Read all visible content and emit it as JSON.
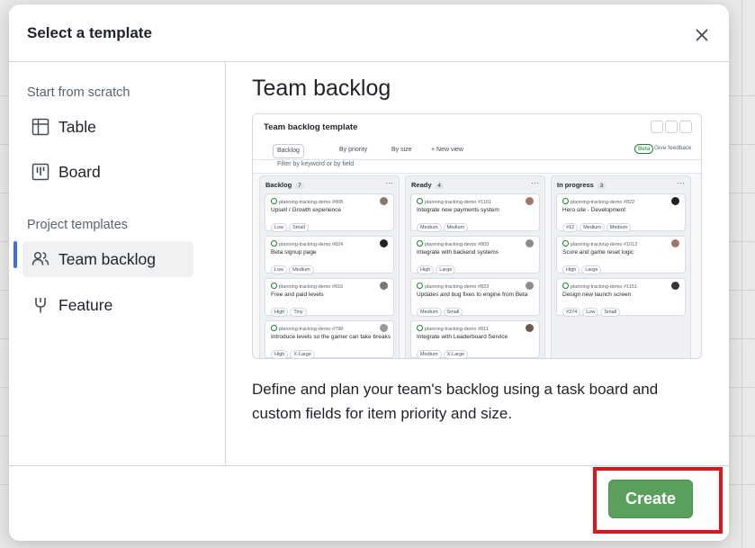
{
  "dialog": {
    "title": "Select a template",
    "close_icon": "close-icon"
  },
  "sidebar": {
    "scratch_label": "Start from scratch",
    "scratch_items": [
      {
        "label": "Table",
        "icon": "table-icon"
      },
      {
        "label": "Board",
        "icon": "board-icon"
      }
    ],
    "templates_label": "Project templates",
    "template_items": [
      {
        "label": "Team backlog",
        "icon": "people-icon",
        "selected": true
      },
      {
        "label": "Feature",
        "icon": "feature-icon",
        "selected": false
      }
    ]
  },
  "detail": {
    "title": "Team backlog",
    "description": "Define and plan your team's backlog using a task board and custom fields for item priority and size."
  },
  "preview": {
    "title": "Team backlog template",
    "tabs": [
      "Backlog",
      "By priority",
      "By size",
      "+  New view"
    ],
    "beta": "Beta",
    "feedback": "Give feedback",
    "filter_placeholder": "Filter by keyword or by field",
    "columns": [
      {
        "name": "Backlog",
        "count": "7",
        "cards": [
          {
            "ref": "planning-tracking-demo #808",
            "title": "Upsell / Growth experience",
            "chips": [
              "Low",
              "Small"
            ]
          },
          {
            "ref": "planning-tracking-demo #824",
            "title": "Beta signup page",
            "chips": [
              "Low",
              "Medium"
            ]
          },
          {
            "ref": "planning-tracking-demo #816",
            "title": "Free and paid levels",
            "chips": [
              "High",
              "Tiny"
            ]
          },
          {
            "ref": "planning-tracking-demo #798",
            "title": "Introduce levels so the gamer can take breaks",
            "chips": [
              "High",
              "X-Large"
            ]
          }
        ]
      },
      {
        "name": "Ready",
        "count": "4",
        "cards": [
          {
            "ref": "planning-tracking-demo #1101",
            "title": "Integrate new payments system",
            "chips": [
              "Medium",
              "Medium"
            ]
          },
          {
            "ref": "planning-tracking-demo #809",
            "title": "Integrate with backend systems",
            "chips": [
              "High",
              "Large"
            ]
          },
          {
            "ref": "planning-tracking-demo #823",
            "title": "Updates and bug fixes to engine from Beta",
            "chips": [
              "Medium",
              "Small"
            ]
          },
          {
            "ref": "planning-tracking-demo #811",
            "title": "Integrate with Leaderboard Service",
            "chips": [
              "Medium",
              "X-Large"
            ]
          }
        ]
      },
      {
        "name": "In progress",
        "count": "3",
        "cards": [
          {
            "ref": "planning-tracking-demo #822",
            "title": "Hero site - Development",
            "chips": [
              "#12",
              "Medium",
              "Medium"
            ]
          },
          {
            "ref": "planning-tracking-demo #1012",
            "title": "Score and game reset logic",
            "chips": [
              "High",
              "Large"
            ]
          },
          {
            "ref": "planning-tracking-demo #1151",
            "title": "Design new launch screen",
            "chips": [
              "#374",
              "Low",
              "Small"
            ]
          }
        ]
      }
    ]
  },
  "footer": {
    "create_label": "Create"
  },
  "colors": {
    "create_button": "#5aa05c",
    "selection_bar": "#3a6ee8",
    "highlight_box": "#e0131a"
  }
}
